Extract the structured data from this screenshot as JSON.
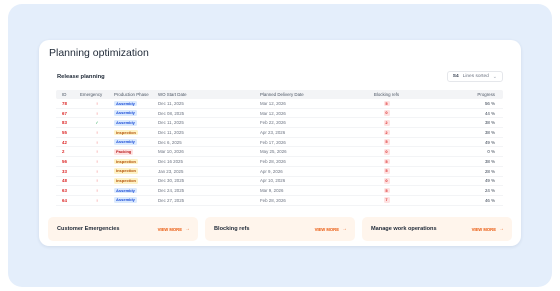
{
  "page": {
    "title": "Planning optimization"
  },
  "release": {
    "title": "Release planning",
    "sort_prefix": "S4",
    "sort_value": "Lines sorted"
  },
  "table": {
    "headers": [
      "ID",
      "Emergency",
      "Production Phase",
      "WO Start Date",
      "Planned Delivery Date",
      "Blocking refs",
      "Progress"
    ],
    "rows": [
      {
        "id": "78",
        "emergency": "alert",
        "phase": "Assembly",
        "phase_kind": "assembly",
        "start": "Dec 11, 2025",
        "delivery": "Mar 12, 2026",
        "blocking": "5",
        "progress": "56 %"
      },
      {
        "id": "67",
        "emergency": "alert",
        "phase": "Assembly",
        "phase_kind": "assembly",
        "start": "Dec 08, 2025",
        "delivery": "Mar 12, 2026",
        "blocking": "0",
        "progress": "44 %"
      },
      {
        "id": "83",
        "emergency": "ok",
        "phase": "Assembly",
        "phase_kind": "assembly",
        "start": "Dec 11, 2025",
        "delivery": "Feb 22, 2026",
        "blocking": "2",
        "progress": "38 %"
      },
      {
        "id": "55",
        "emergency": "alert",
        "phase": "Inspection",
        "phase_kind": "inspection",
        "start": "Dec 11, 2025",
        "delivery": "Apr 23, 2026",
        "blocking": "2",
        "progress": "38 %"
      },
      {
        "id": "42",
        "emergency": "alert",
        "phase": "Assembly",
        "phase_kind": "assembly",
        "start": "Dec 6, 2025",
        "delivery": "Feb 17, 2026",
        "blocking": "5",
        "progress": "49 %"
      },
      {
        "id": "2",
        "emergency": "alert",
        "phase": "Packing",
        "phase_kind": "packing",
        "start": "Mar 10, 2026",
        "delivery": "May 25, 2026",
        "blocking": "0",
        "progress": "0 %"
      },
      {
        "id": "56",
        "emergency": "alert",
        "phase": "Inspection",
        "phase_kind": "inspection",
        "start": "Dec 16 2025",
        "delivery": "Feb 28, 2026",
        "blocking": "5",
        "progress": "38 %"
      },
      {
        "id": "33",
        "emergency": "alert",
        "phase": "Inspection",
        "phase_kind": "inspection",
        "start": "Jan 23, 2025",
        "delivery": "Apr 9, 2026",
        "blocking": "5",
        "progress": "28 %"
      },
      {
        "id": "48",
        "emergency": "alert",
        "phase": "Inspection",
        "phase_kind": "inspection",
        "start": "Dec 30, 2025",
        "delivery": "Apr 10, 2026",
        "blocking": "0",
        "progress": "49 %"
      },
      {
        "id": "63",
        "emergency": "alert",
        "phase": "Assembly",
        "phase_kind": "assembly",
        "start": "Dec 24, 2025",
        "delivery": "Mar 9, 2026",
        "blocking": "5",
        "progress": "24 %"
      },
      {
        "id": "64",
        "emergency": "alert",
        "phase": "Assembly",
        "phase_kind": "assembly",
        "start": "Dec 27, 2025",
        "delivery": "Feb 28, 2026",
        "blocking": "7",
        "progress": "46 %"
      }
    ]
  },
  "cards": [
    {
      "title": "Customer Emergencies",
      "link": "VIEW MORE"
    },
    {
      "title": "Blocking refs",
      "link": "VIEW MORE"
    },
    {
      "title": "Manage work operations",
      "link": "VIEW MORE"
    }
  ],
  "icons": {
    "alert": "!",
    "ok": "✓",
    "arrow": "→",
    "chevron": "⌄"
  },
  "colors": {
    "accent": "#ea580c",
    "danger": "#dc2626",
    "backdrop": "#e4eefb"
  }
}
